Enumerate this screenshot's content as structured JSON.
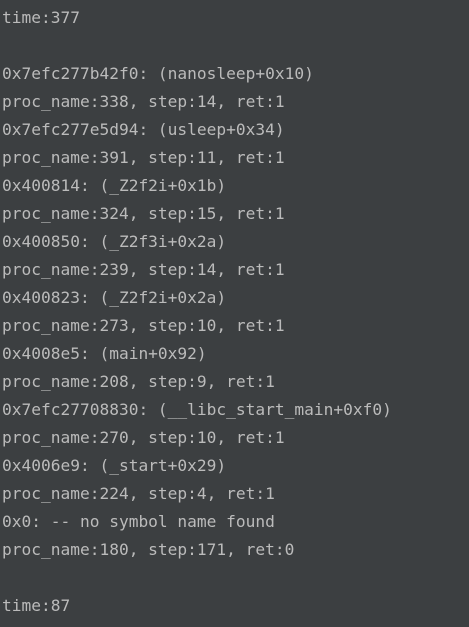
{
  "console": {
    "lines": [
      "time:377",
      "",
      "0x7efc277b42f0: (nanosleep+0x10)",
      "proc_name:338, step:14, ret:1",
      "0x7efc277e5d94: (usleep+0x34)",
      "proc_name:391, step:11, ret:1",
      "0x400814: (_Z2f2i+0x1b)",
      "proc_name:324, step:15, ret:1",
      "0x400850: (_Z2f3i+0x2a)",
      "proc_name:239, step:14, ret:1",
      "0x400823: (_Z2f2i+0x2a)",
      "proc_name:273, step:10, ret:1",
      "0x4008e5: (main+0x92)",
      "proc_name:208, step:9, ret:1",
      "0x7efc27708830: (__libc_start_main+0xf0)",
      "proc_name:270, step:10, ret:1",
      "0x4006e9: (_start+0x29)",
      "proc_name:224, step:4, ret:1",
      "0x0: -- no symbol name found",
      "proc_name:180, step:171, ret:0",
      "",
      "time:87"
    ]
  }
}
